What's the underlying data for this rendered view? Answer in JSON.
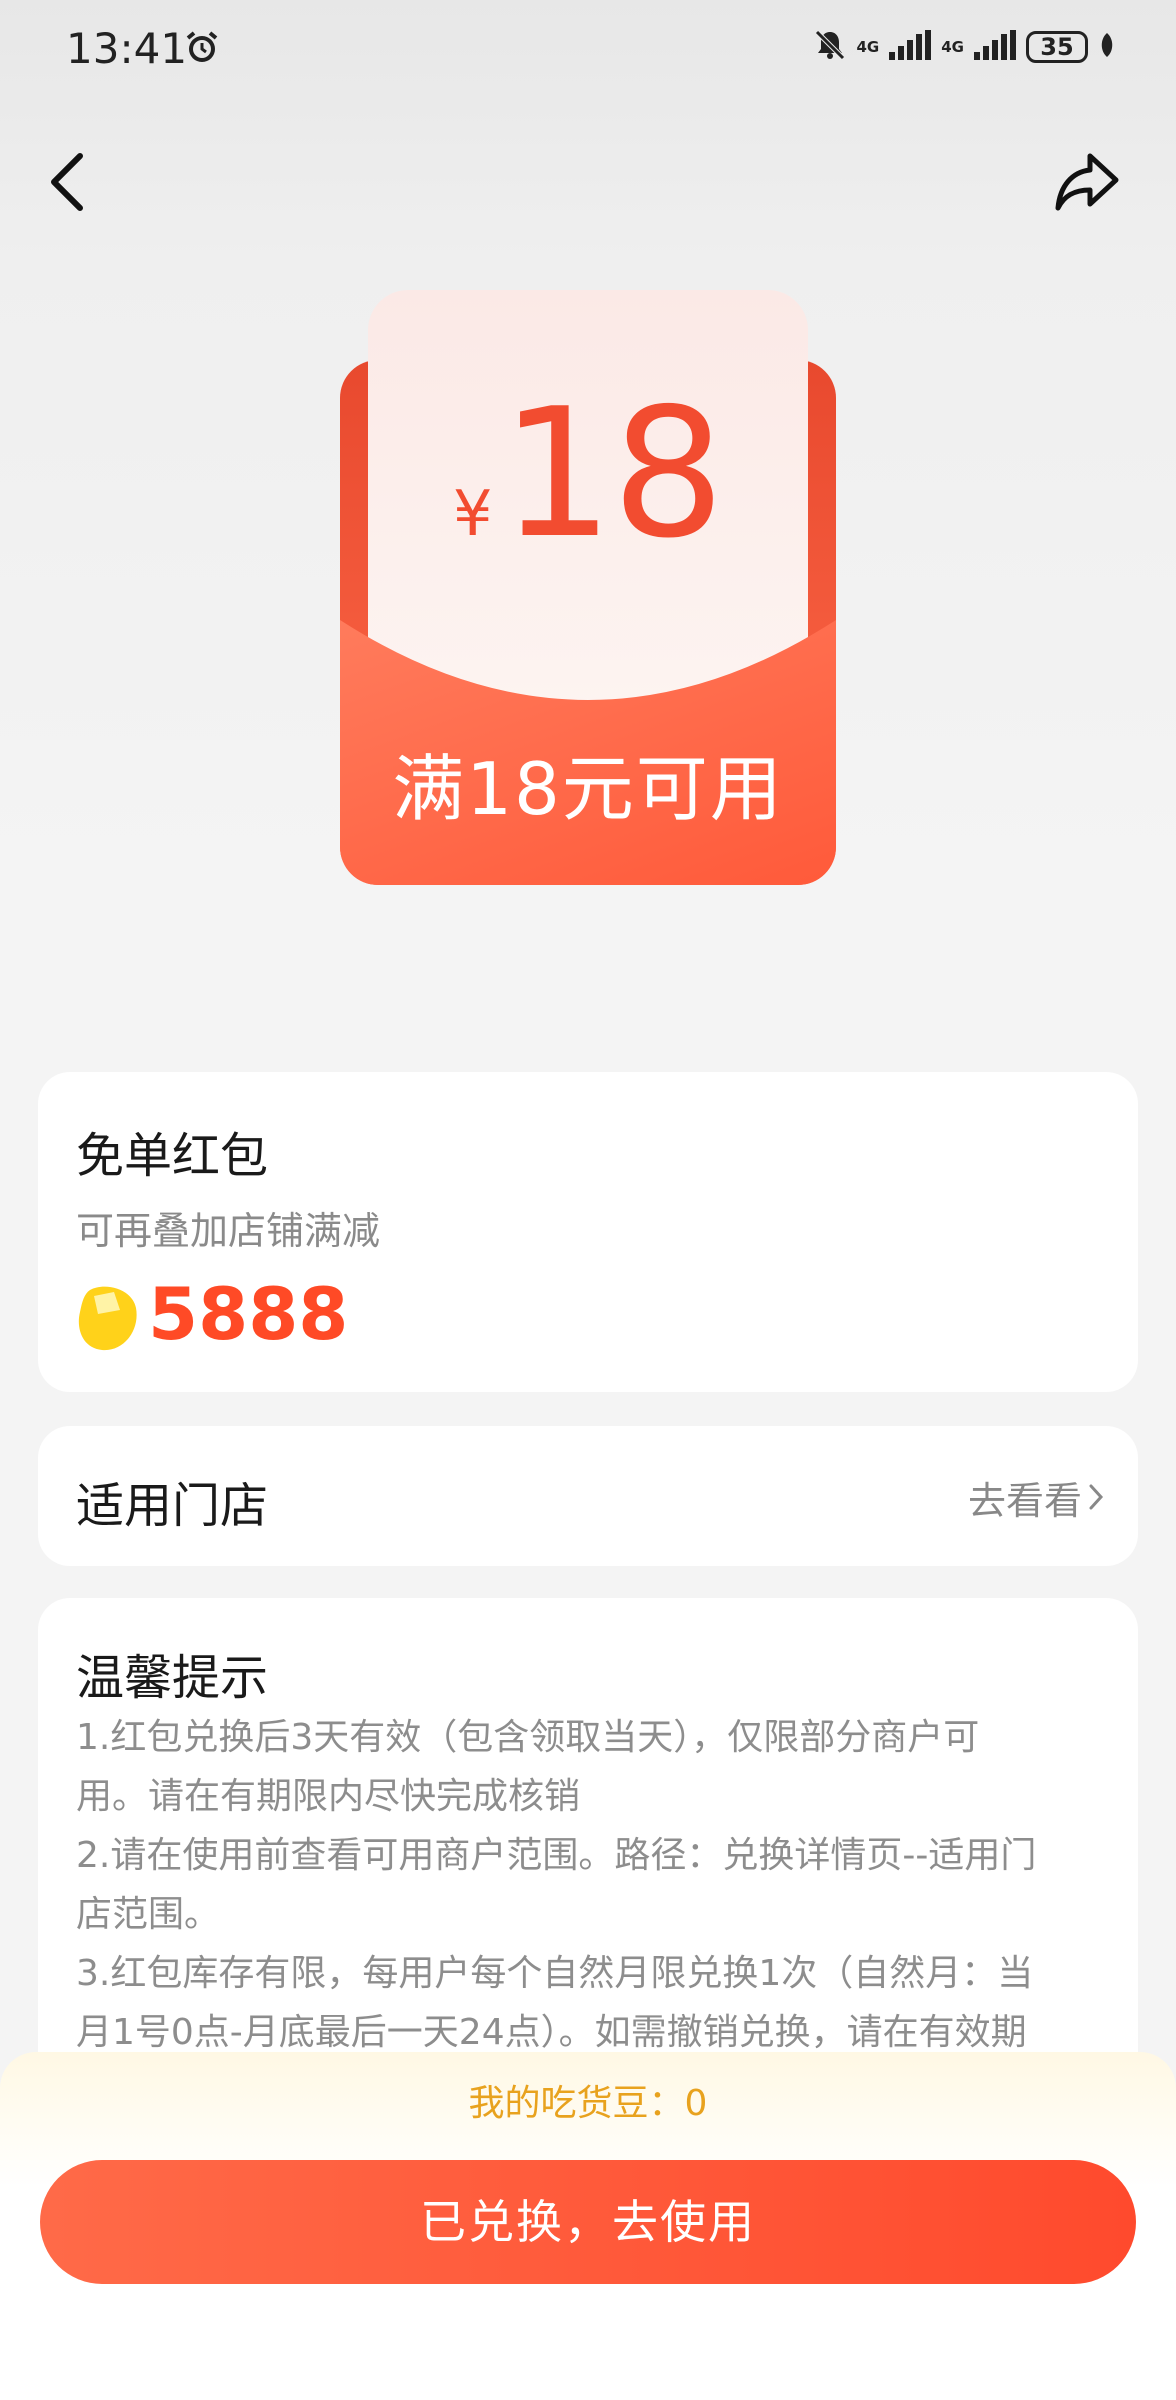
{
  "status_bar": {
    "time": "13:41",
    "network_1": "4G",
    "network_2": "4G",
    "battery": "35",
    "icons": [
      "alarm-icon",
      "mute-bell-icon",
      "signal-icon",
      "battery-icon",
      "leaf-icon"
    ]
  },
  "nav": {
    "back_icon": "chevron-left-icon",
    "share_icon": "share-icon"
  },
  "coupon": {
    "currency": "¥",
    "amount": "18",
    "threshold": "满18元可用",
    "colors": {
      "accent": "#f24c30",
      "envelope": "#ff6b4a"
    }
  },
  "offer_card": {
    "title": "免单红包",
    "subtitle": "可再叠加店铺满减",
    "points": "5888",
    "coin_icon": "coin-icon"
  },
  "stores_card": {
    "title": "适用门店",
    "link": "去看看"
  },
  "tips_card": {
    "title": "温馨提示",
    "lines": [
      "1.红包兑换后3天有效（包含领取当天），仅限部分商户可",
      "用。请在有期限内尽快完成核销",
      "2.请在使用前查看可用商户范围。路径：兑换详情页--适用门",
      "店范围。",
      "3.红包库存有限，每用户每个自然月限兑换1次（自然月：当",
      "月1号0点-月底最后一天24点）。如需撤销兑换，请在有效期"
    ]
  },
  "footer": {
    "beans_label": "我的吃货豆：0",
    "cta_label": "已兑换，去使用",
    "cta_color": "#ff5a3a"
  }
}
